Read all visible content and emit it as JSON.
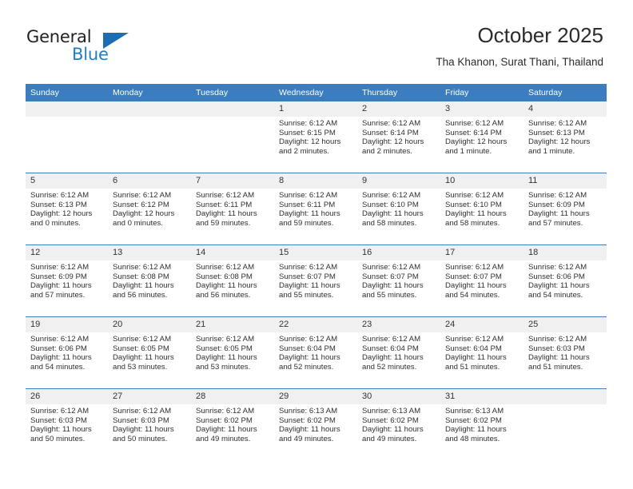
{
  "brand": {
    "name_part1": "General",
    "name_part2": "Blue",
    "accent_color": "#1c6eb4",
    "text_color": "#231f20"
  },
  "header": {
    "title": "October 2025",
    "subtitle": "Tha Khanon, Surat Thani, Thailand"
  },
  "calendar": {
    "header_bg": "#3b7dbf",
    "daynum_bg": "#f0f0f0",
    "weekdays": [
      "Sunday",
      "Monday",
      "Tuesday",
      "Wednesday",
      "Thursday",
      "Friday",
      "Saturday"
    ],
    "weeks": [
      [
        {
          "day": "",
          "empty": true
        },
        {
          "day": "",
          "empty": true
        },
        {
          "day": "",
          "empty": true
        },
        {
          "day": "1",
          "sunrise": "Sunrise: 6:12 AM",
          "sunset": "Sunset: 6:15 PM",
          "daylight1": "Daylight: 12 hours",
          "daylight2": "and 2 minutes."
        },
        {
          "day": "2",
          "sunrise": "Sunrise: 6:12 AM",
          "sunset": "Sunset: 6:14 PM",
          "daylight1": "Daylight: 12 hours",
          "daylight2": "and 2 minutes."
        },
        {
          "day": "3",
          "sunrise": "Sunrise: 6:12 AM",
          "sunset": "Sunset: 6:14 PM",
          "daylight1": "Daylight: 12 hours",
          "daylight2": "and 1 minute."
        },
        {
          "day": "4",
          "sunrise": "Sunrise: 6:12 AM",
          "sunset": "Sunset: 6:13 PM",
          "daylight1": "Daylight: 12 hours",
          "daylight2": "and 1 minute."
        }
      ],
      [
        {
          "day": "5",
          "sunrise": "Sunrise: 6:12 AM",
          "sunset": "Sunset: 6:13 PM",
          "daylight1": "Daylight: 12 hours",
          "daylight2": "and 0 minutes."
        },
        {
          "day": "6",
          "sunrise": "Sunrise: 6:12 AM",
          "sunset": "Sunset: 6:12 PM",
          "daylight1": "Daylight: 12 hours",
          "daylight2": "and 0 minutes."
        },
        {
          "day": "7",
          "sunrise": "Sunrise: 6:12 AM",
          "sunset": "Sunset: 6:11 PM",
          "daylight1": "Daylight: 11 hours",
          "daylight2": "and 59 minutes."
        },
        {
          "day": "8",
          "sunrise": "Sunrise: 6:12 AM",
          "sunset": "Sunset: 6:11 PM",
          "daylight1": "Daylight: 11 hours",
          "daylight2": "and 59 minutes."
        },
        {
          "day": "9",
          "sunrise": "Sunrise: 6:12 AM",
          "sunset": "Sunset: 6:10 PM",
          "daylight1": "Daylight: 11 hours",
          "daylight2": "and 58 minutes."
        },
        {
          "day": "10",
          "sunrise": "Sunrise: 6:12 AM",
          "sunset": "Sunset: 6:10 PM",
          "daylight1": "Daylight: 11 hours",
          "daylight2": "and 58 minutes."
        },
        {
          "day": "11",
          "sunrise": "Sunrise: 6:12 AM",
          "sunset": "Sunset: 6:09 PM",
          "daylight1": "Daylight: 11 hours",
          "daylight2": "and 57 minutes."
        }
      ],
      [
        {
          "day": "12",
          "sunrise": "Sunrise: 6:12 AM",
          "sunset": "Sunset: 6:09 PM",
          "daylight1": "Daylight: 11 hours",
          "daylight2": "and 57 minutes."
        },
        {
          "day": "13",
          "sunrise": "Sunrise: 6:12 AM",
          "sunset": "Sunset: 6:08 PM",
          "daylight1": "Daylight: 11 hours",
          "daylight2": "and 56 minutes."
        },
        {
          "day": "14",
          "sunrise": "Sunrise: 6:12 AM",
          "sunset": "Sunset: 6:08 PM",
          "daylight1": "Daylight: 11 hours",
          "daylight2": "and 56 minutes."
        },
        {
          "day": "15",
          "sunrise": "Sunrise: 6:12 AM",
          "sunset": "Sunset: 6:07 PM",
          "daylight1": "Daylight: 11 hours",
          "daylight2": "and 55 minutes."
        },
        {
          "day": "16",
          "sunrise": "Sunrise: 6:12 AM",
          "sunset": "Sunset: 6:07 PM",
          "daylight1": "Daylight: 11 hours",
          "daylight2": "and 55 minutes."
        },
        {
          "day": "17",
          "sunrise": "Sunrise: 6:12 AM",
          "sunset": "Sunset: 6:07 PM",
          "daylight1": "Daylight: 11 hours",
          "daylight2": "and 54 minutes."
        },
        {
          "day": "18",
          "sunrise": "Sunrise: 6:12 AM",
          "sunset": "Sunset: 6:06 PM",
          "daylight1": "Daylight: 11 hours",
          "daylight2": "and 54 minutes."
        }
      ],
      [
        {
          "day": "19",
          "sunrise": "Sunrise: 6:12 AM",
          "sunset": "Sunset: 6:06 PM",
          "daylight1": "Daylight: 11 hours",
          "daylight2": "and 54 minutes."
        },
        {
          "day": "20",
          "sunrise": "Sunrise: 6:12 AM",
          "sunset": "Sunset: 6:05 PM",
          "daylight1": "Daylight: 11 hours",
          "daylight2": "and 53 minutes."
        },
        {
          "day": "21",
          "sunrise": "Sunrise: 6:12 AM",
          "sunset": "Sunset: 6:05 PM",
          "daylight1": "Daylight: 11 hours",
          "daylight2": "and 53 minutes."
        },
        {
          "day": "22",
          "sunrise": "Sunrise: 6:12 AM",
          "sunset": "Sunset: 6:04 PM",
          "daylight1": "Daylight: 11 hours",
          "daylight2": "and 52 minutes."
        },
        {
          "day": "23",
          "sunrise": "Sunrise: 6:12 AM",
          "sunset": "Sunset: 6:04 PM",
          "daylight1": "Daylight: 11 hours",
          "daylight2": "and 52 minutes."
        },
        {
          "day": "24",
          "sunrise": "Sunrise: 6:12 AM",
          "sunset": "Sunset: 6:04 PM",
          "daylight1": "Daylight: 11 hours",
          "daylight2": "and 51 minutes."
        },
        {
          "day": "25",
          "sunrise": "Sunrise: 6:12 AM",
          "sunset": "Sunset: 6:03 PM",
          "daylight1": "Daylight: 11 hours",
          "daylight2": "and 51 minutes."
        }
      ],
      [
        {
          "day": "26",
          "sunrise": "Sunrise: 6:12 AM",
          "sunset": "Sunset: 6:03 PM",
          "daylight1": "Daylight: 11 hours",
          "daylight2": "and 50 minutes."
        },
        {
          "day": "27",
          "sunrise": "Sunrise: 6:12 AM",
          "sunset": "Sunset: 6:03 PM",
          "daylight1": "Daylight: 11 hours",
          "daylight2": "and 50 minutes."
        },
        {
          "day": "28",
          "sunrise": "Sunrise: 6:12 AM",
          "sunset": "Sunset: 6:02 PM",
          "daylight1": "Daylight: 11 hours",
          "daylight2": "and 49 minutes."
        },
        {
          "day": "29",
          "sunrise": "Sunrise: 6:13 AM",
          "sunset": "Sunset: 6:02 PM",
          "daylight1": "Daylight: 11 hours",
          "daylight2": "and 49 minutes."
        },
        {
          "day": "30",
          "sunrise": "Sunrise: 6:13 AM",
          "sunset": "Sunset: 6:02 PM",
          "daylight1": "Daylight: 11 hours",
          "daylight2": "and 49 minutes."
        },
        {
          "day": "31",
          "sunrise": "Sunrise: 6:13 AM",
          "sunset": "Sunset: 6:02 PM",
          "daylight1": "Daylight: 11 hours",
          "daylight2": "and 48 minutes."
        },
        {
          "day": "",
          "empty": true
        }
      ]
    ]
  }
}
